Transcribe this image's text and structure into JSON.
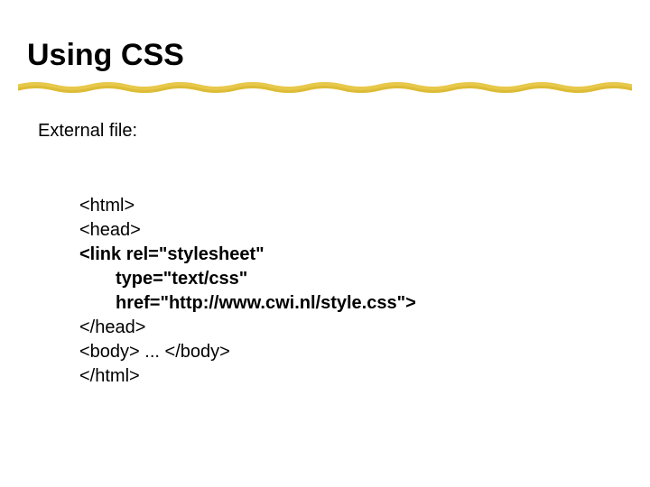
{
  "title": "Using CSS",
  "subtitle": "External file:",
  "code": {
    "l1": "<html>",
    "l2": "<head>",
    "l3": "<link rel=\"stylesheet\"",
    "l4": "type=\"text/css\"",
    "l5": "href=\"http://www.cwi.nl/style.css\">",
    "l6": "</head>",
    "l7": "<body> ... </body>",
    "l8": "</html>"
  }
}
